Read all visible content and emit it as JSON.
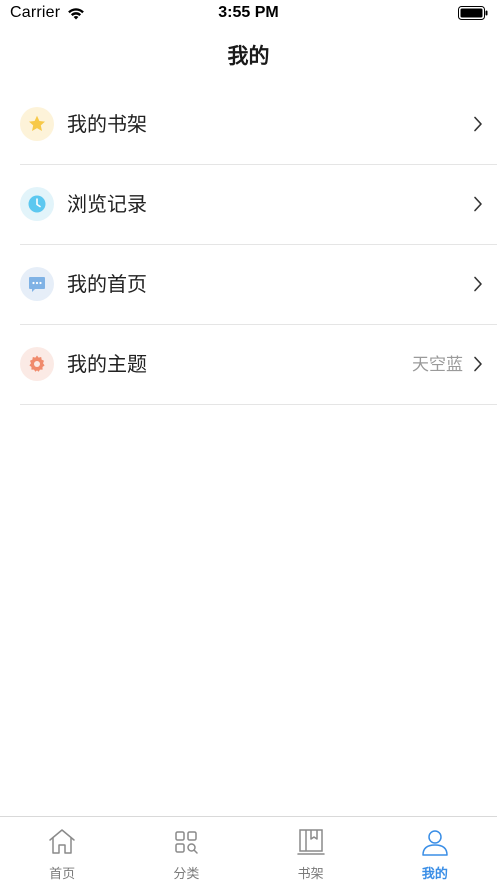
{
  "status_bar": {
    "carrier": "Carrier",
    "time": "3:55 PM",
    "wifi_icon": "wifi-icon",
    "battery_icon": "battery-full-icon"
  },
  "header": {
    "title": "我的"
  },
  "menu": {
    "items": [
      {
        "label": "我的书架",
        "icon": "star-icon",
        "icon_bg": "#fdf3d9",
        "icon_color": "#f7c948",
        "value": ""
      },
      {
        "label": "浏览记录",
        "icon": "clock-icon",
        "icon_bg": "#e2f4fa",
        "icon_color": "#5cc8f0",
        "value": ""
      },
      {
        "label": "我的首页",
        "icon": "message-icon",
        "icon_bg": "#e6eef8",
        "icon_color": "#7fb2e5",
        "value": ""
      },
      {
        "label": "我的主题",
        "icon": "gear-icon",
        "icon_bg": "#fbeae5",
        "icon_color": "#f08a6c",
        "value": "天空蓝"
      }
    ]
  },
  "tab_bar": {
    "tabs": [
      {
        "label": "首页",
        "icon": "home-icon",
        "active": false
      },
      {
        "label": "分类",
        "icon": "category-icon",
        "active": false
      },
      {
        "label": "书架",
        "icon": "bookshelf-icon",
        "active": false
      },
      {
        "label": "我的",
        "icon": "profile-icon",
        "active": true
      }
    ],
    "active_color": "#3a8ee6",
    "inactive_color": "#7a7a7a"
  }
}
